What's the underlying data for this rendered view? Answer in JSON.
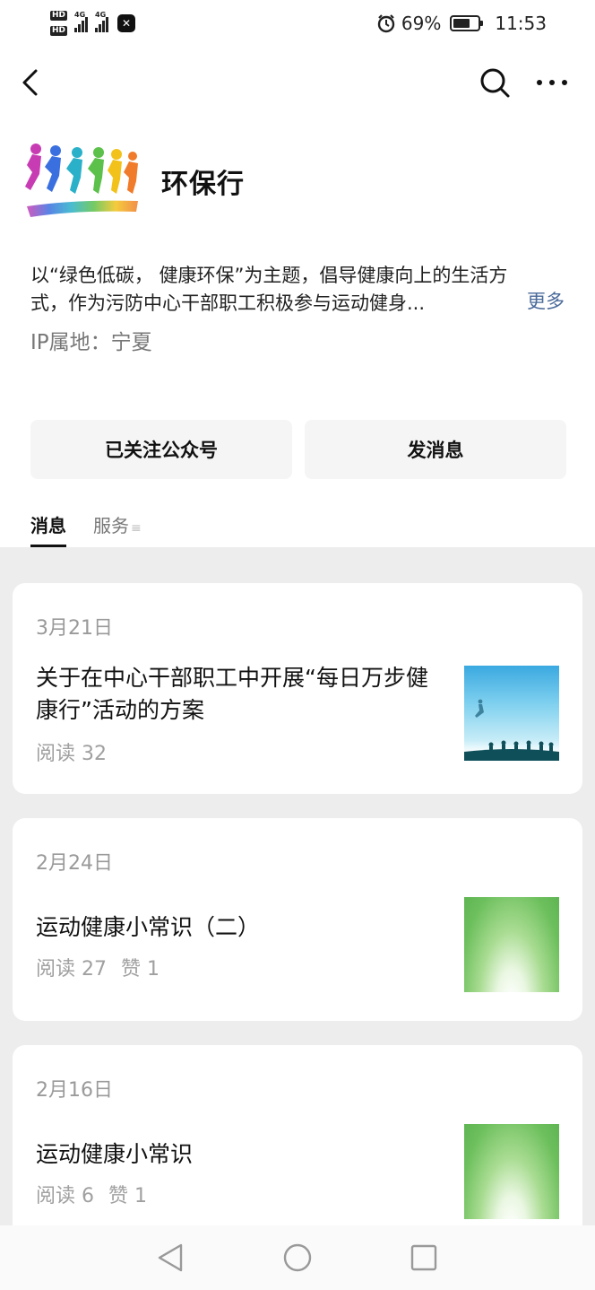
{
  "status_bar": {
    "hd1": "HD",
    "hd2": "HD",
    "net1": "4G",
    "net2": "4G",
    "app_badge": "✕",
    "alarm_icon": "alarm-icon",
    "battery_text": "69%",
    "battery_level": 0.69,
    "time": "11:53"
  },
  "nav": {
    "back_icon": "chevron-left-icon",
    "search_icon": "search-icon",
    "more_icon": "more-icon"
  },
  "profile": {
    "name": "环保行",
    "description": "以“绿色低碳， 健康环保”为主题，倡导健康向上的生活方式，作为污防中心干部职工积极参与运动健身...",
    "more_label": "更多",
    "ip_location": "IP属地：宁夏"
  },
  "actions": {
    "followed_label": "已关注公众号",
    "message_label": "发消息"
  },
  "tabs": [
    {
      "label": "消息",
      "active": true
    },
    {
      "label": "服务",
      "active": false
    }
  ],
  "articles": [
    {
      "date": "3月21日",
      "title": "关于在中心干部职工中开展“每日万步健康行”活动的方案",
      "reads": "阅读 32",
      "likes": ""
    },
    {
      "date": "2月24日",
      "title": "运动健康小常识（二）",
      "reads": "阅读 27",
      "likes": "赞 1"
    },
    {
      "date": "2月16日",
      "title": "运动健康小常识",
      "reads": "阅读 6",
      "likes": "赞 1"
    }
  ]
}
